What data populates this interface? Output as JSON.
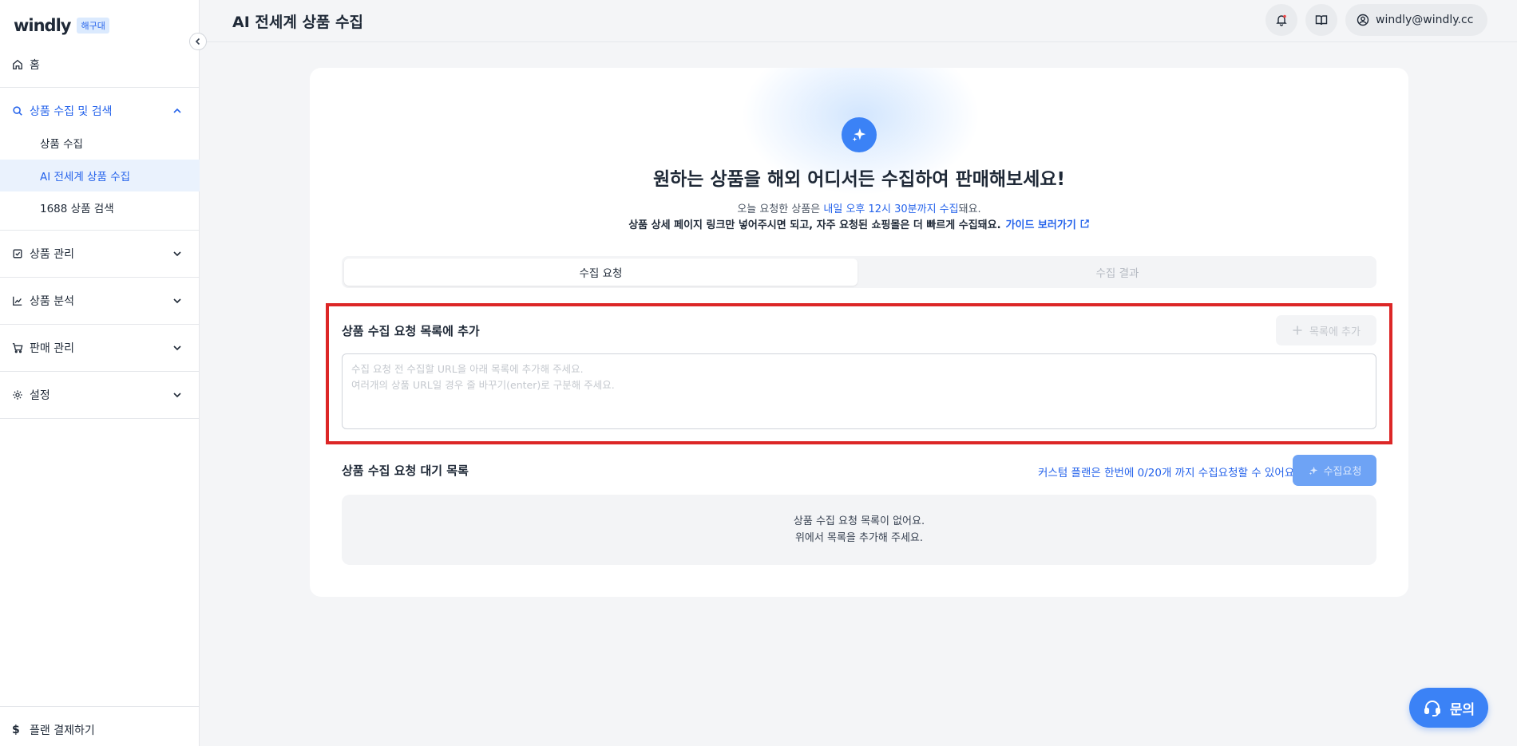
{
  "sidebar": {
    "logo": "windly",
    "badge": "해구대",
    "home": "홈",
    "group_collect": "상품 수집 및 검색",
    "sub_items": [
      "상품 수집",
      "AI 전세계 상품 수집",
      "1688 상품 검색"
    ],
    "selected_sub": "AI 전세계 상품 수집",
    "product_manage": "상품 관리",
    "product_analysis": "상품 분석",
    "sales_manage": "판매 관리",
    "settings": "설정",
    "plan_pay": "플랜 결제하기"
  },
  "header": {
    "title": "AI 전세계 상품 수집",
    "user_email": "windly@windly.cc"
  },
  "main": {
    "headline": "원하는 상품을 해외 어디서든 수집하여 판매해보세요!",
    "sub1_prefix": "오늘 요청한 상품은 ",
    "sub1_highlight": "내일 오후 12시 30분까지 수집",
    "sub1_suffix": "돼요.",
    "sub2": "상품 상세 페이지 링크만 넣어주시면 되고, 자주 요청된 쇼핑몰은 더 빠르게 수집돼요.",
    "guide_link": "가이드 보러가기",
    "tabs": [
      {
        "label": "수집 요청",
        "active": true
      },
      {
        "label": "수집 결과",
        "active": false
      }
    ],
    "add_section_title": "상품 수집 요청 목록에 추가",
    "add_button": "목록에 추가",
    "url_input": {
      "value": "",
      "placeholder": "수집 요청 전 수집할 URL을 아래 목록에 추가해 주세요.\n여러개의 상품 URL일 경우 줄 바꾸기(enter)로 구분해 주세요."
    },
    "queue_title": "상품 수집 요청 대기 목록",
    "limit_text": "커스텀 플랜은 한번에 0/20개 까지 수집요청할 수 있어요.",
    "request_button": "수집요청",
    "empty_line1": "상품 수집 요청 목록이 없어요.",
    "empty_line2": "위에서 목록을 추가해 주세요."
  },
  "fab": {
    "label": "문의"
  },
  "icons": [
    "home-icon",
    "search-icon",
    "chevron-up-icon",
    "chevron-down-icon",
    "clipboard-check-icon",
    "chart-line-icon",
    "cart-icon",
    "gear-icon",
    "dollar-icon",
    "chevron-left-icon",
    "bell-icon",
    "book-icon",
    "user-circle-icon",
    "sparkle-icon",
    "external-link-icon",
    "plus-icon",
    "headset-icon"
  ],
  "colors": {
    "accent": "#3b82f6",
    "link": "#2563eb",
    "highlight_border": "#dc2626",
    "selected_bg": "#eaf2fd"
  }
}
